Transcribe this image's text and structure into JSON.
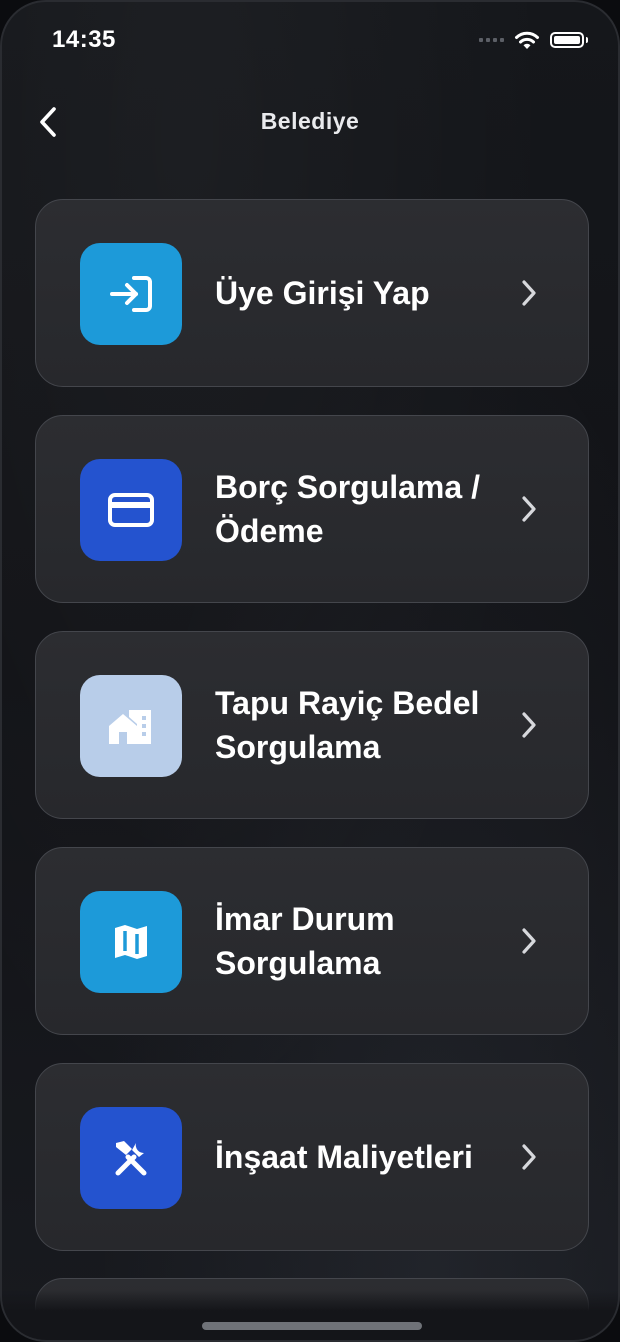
{
  "status_bar": {
    "time": "14:35"
  },
  "nav": {
    "title": "Belediye",
    "back_icon": "chevron-left-icon"
  },
  "menu": [
    {
      "label": "Üye Girişi Yap",
      "icon": "login-icon",
      "icon_bg": "#1d9ad9"
    },
    {
      "label": "Borç Sorgulama / Ödeme",
      "icon": "credit-card-icon",
      "icon_bg": "#2453cf"
    },
    {
      "label": "Tapu Rayiç Bedel Sorgulama",
      "icon": "building-icon",
      "icon_bg": "#b8cde9"
    },
    {
      "label": "İmar Durum Sorgulama",
      "icon": "map-icon",
      "icon_bg": "#1d9ad9"
    },
    {
      "label": "İnşaat Maliyetleri",
      "icon": "tools-icon",
      "icon_bg": "#2453cf"
    }
  ]
}
